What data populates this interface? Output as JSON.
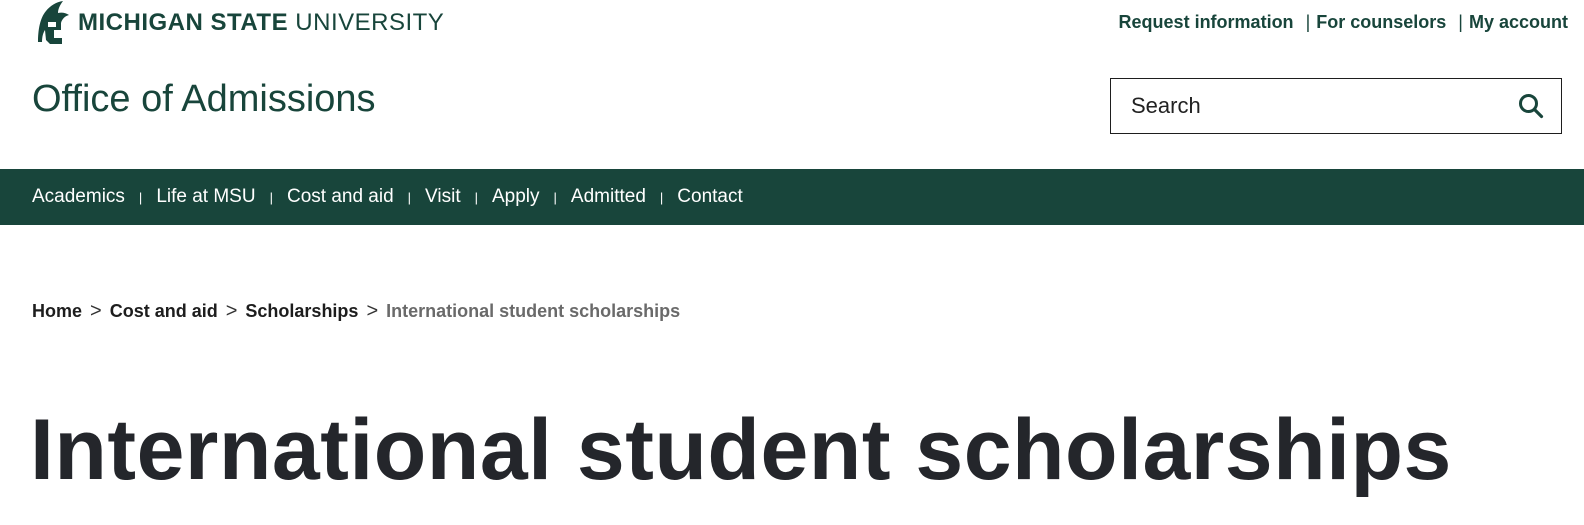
{
  "brand": {
    "name_bold": "MICHIGAN STATE",
    "name_light": "UNIVERSITY",
    "logo_icon": "spartan-helmet-icon",
    "color": "#18453b"
  },
  "utility_links": [
    "Request information",
    "For counselors",
    "My account"
  ],
  "utility_separator": "|",
  "site_title": "Office of Admissions",
  "search": {
    "placeholder": "Search",
    "icon": "search-icon"
  },
  "nav": {
    "items": [
      "Academics",
      "Life at MSU",
      "Cost and aid",
      "Visit",
      "Apply",
      "Admitted",
      "Contact"
    ],
    "separator": "|",
    "background": "#18453b"
  },
  "breadcrumb": {
    "items": [
      "Home",
      "Cost and aid",
      "Scholarships"
    ],
    "current": "International student scholarships",
    "separator": ">"
  },
  "page_title": "International student scholarships"
}
